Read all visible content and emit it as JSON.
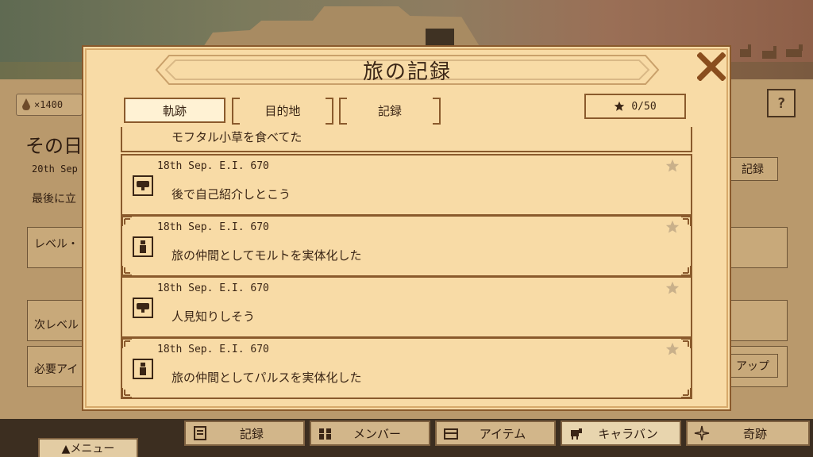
{
  "background": {
    "currency": {
      "icon": "drop-icon",
      "amount": "×1400"
    },
    "day_title": "その日",
    "date": "20th Sep",
    "last_stop": "最後に立",
    "level_label": "レベル・",
    "next_level_label": "次レベル",
    "required_label": "必要アイ",
    "record_button": "記録",
    "up_button": "アップ",
    "help_icon": "?"
  },
  "modal": {
    "title": "旅の記録",
    "close_icon": "close-x-icon",
    "filters": [
      {
        "label": "軌跡",
        "active": true
      },
      {
        "label": "目的地",
        "active": false
      },
      {
        "label": "記録",
        "active": false
      }
    ],
    "star_counter": "0/50",
    "entries": [
      {
        "date": "",
        "text": "モフタル小草を食べてた",
        "icon": "speech-bubble-icon",
        "starred": false,
        "ornate": false,
        "partial": true
      },
      {
        "date": "18th Sep. E.I. 670",
        "text": "後で自己紹介しとこう",
        "icon": "speech-bubble-icon",
        "starred": false,
        "ornate": false
      },
      {
        "date": "18th Sep. E.I. 670",
        "text": "旅の仲間としてモルトを実体化した",
        "icon": "person-icon",
        "starred": false,
        "ornate": true
      },
      {
        "date": "18th Sep. E.I. 670",
        "text": "人見知りしそう",
        "icon": "speech-bubble-icon",
        "starred": false,
        "ornate": false
      },
      {
        "date": "18th Sep. E.I. 670",
        "text": "旅の仲間としてパルスを実体化した",
        "icon": "person-icon",
        "starred": false,
        "ornate": true
      }
    ]
  },
  "bottom_tabs": [
    {
      "label": "記録",
      "icon": "document-icon",
      "active": false
    },
    {
      "label": "メンバー",
      "icon": "members-icon",
      "active": false
    },
    {
      "label": "アイテム",
      "icon": "chest-icon",
      "active": false
    },
    {
      "label": "キャラバン",
      "icon": "caravan-icon",
      "active": true
    },
    {
      "label": "奇跡",
      "icon": "sparkle-icon",
      "active": false
    }
  ],
  "menu_button": "▲メニュー",
  "colors": {
    "panel": "#f8dba6",
    "border": "#8a5a2c",
    "text": "#3b2616",
    "star": "#c9b08a"
  }
}
